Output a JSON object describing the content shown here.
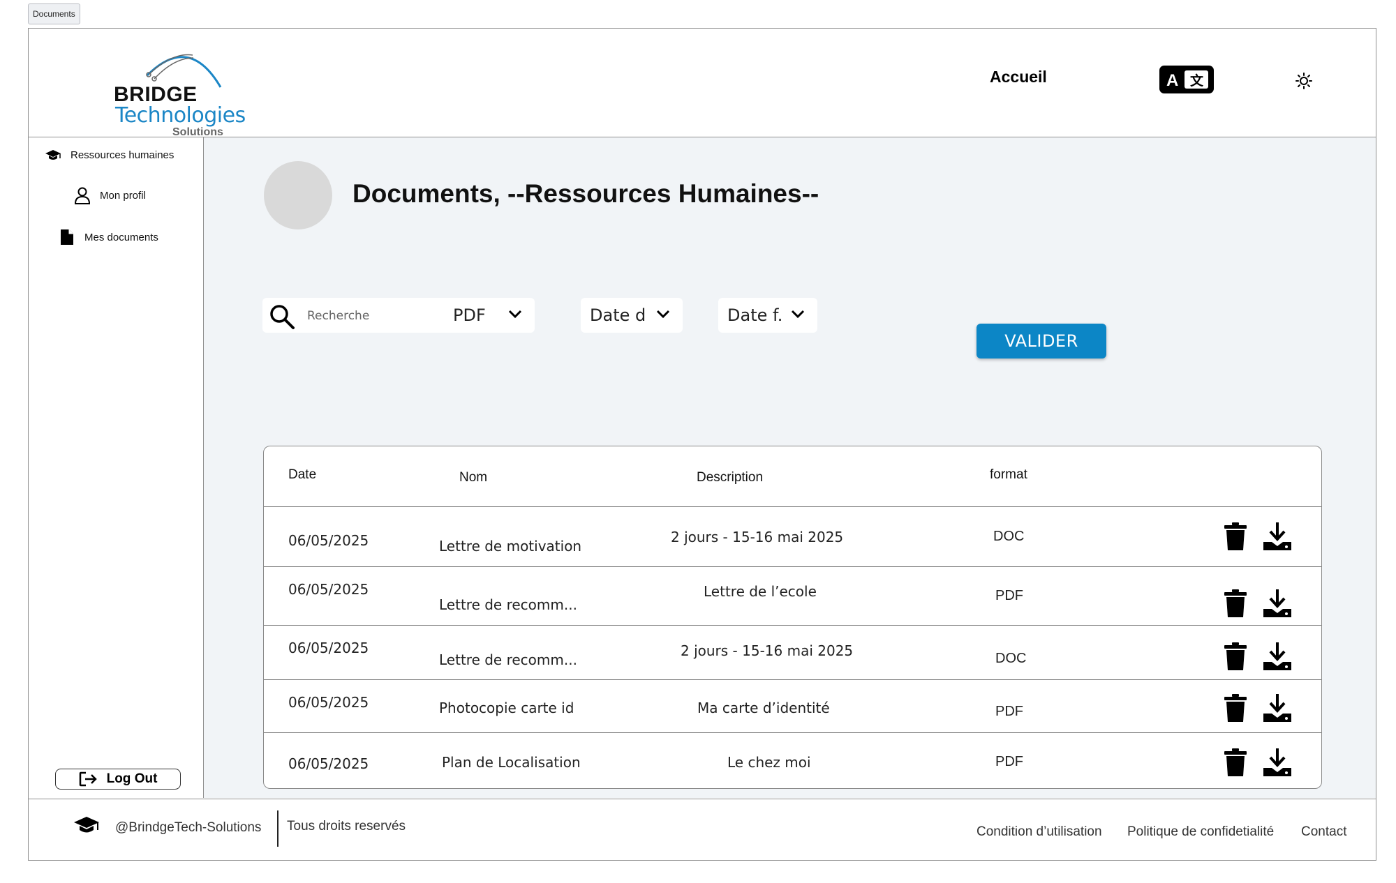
{
  "tab": {
    "label": "Documents"
  },
  "logo": {
    "line1": "BRIDGE",
    "line2": "Technologies",
    "line3": "Solutions"
  },
  "header": {
    "nav_home": "Accueil",
    "translate_icon": "translate-icon",
    "theme_icon": "sun-icon"
  },
  "sidebar": {
    "items": [
      {
        "label": "Ressources humaines",
        "icon": "graduation-cap-icon"
      },
      {
        "label": "Mon profil",
        "icon": "user-icon"
      },
      {
        "label": "Mes documents",
        "icon": "document-icon"
      }
    ],
    "logout_label": "Log Out"
  },
  "main": {
    "title": "Documents, --Ressources Humaines--",
    "filters": {
      "search_placeholder": "Recherche",
      "format_value": "PDF",
      "date_start_value": "Date d",
      "date_end_value": "Date f.",
      "submit_label": "VALIDER"
    },
    "table": {
      "headers": {
        "date": "Date",
        "name": "Nom",
        "description": "Description",
        "format": "format"
      },
      "rows": [
        {
          "date": "06/05/2025",
          "name": "Lettre de motivation",
          "description": "2 jours - 15-16 mai 2025",
          "format": "DOC"
        },
        {
          "date": "06/05/2025",
          "name": "Lettre de recomm...",
          "description": "Lettre de l’ecole",
          "format": "PDF"
        },
        {
          "date": "06/05/2025",
          "name": "Lettre de recomm...",
          "description": "2 jours - 15-16 mai 2025",
          "format": "DOC"
        },
        {
          "date": "06/05/2025",
          "name": "Photocopie carte id",
          "description": "Ma carte d’identité",
          "format": "PDF"
        },
        {
          "date": "06/05/2025",
          "name": "Plan de Localisation",
          "description": "Le chez moi",
          "format": "PDF"
        }
      ]
    }
  },
  "footer": {
    "handle": "@BrindgeTech-Solutions",
    "rights": "Tous droits reservés",
    "links": [
      "Condition d’utilisation",
      "Politique de confidetialité",
      "Contact"
    ]
  },
  "colors": {
    "accent": "#0c86c6",
    "content_bg": "#f1f4f7",
    "avatar": "#d9d9d9"
  }
}
